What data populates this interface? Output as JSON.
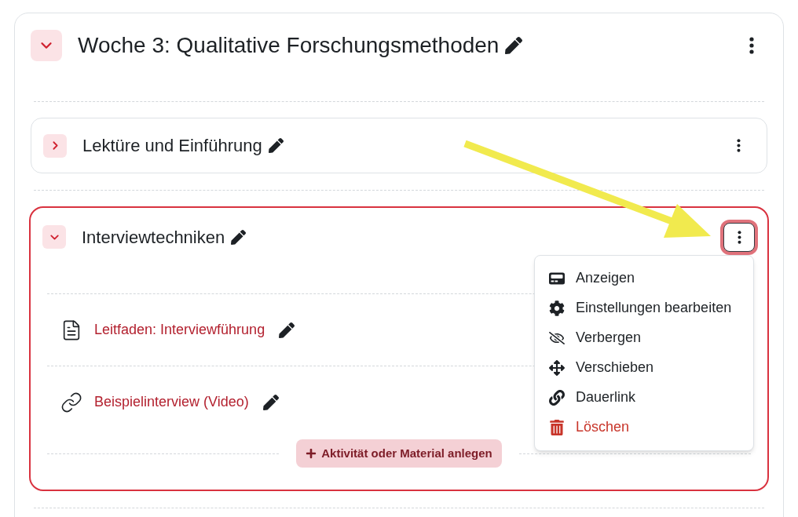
{
  "section": {
    "title": "Woche 3: Qualitative Forschungsmethoden",
    "expanded": true,
    "subsections": [
      {
        "title": "Lektüre und Einführung",
        "expanded": false,
        "highlighted": false,
        "menu_open": false
      },
      {
        "title": "Interviewtechniken",
        "expanded": true,
        "highlighted": true,
        "menu_open": true,
        "activities": [
          {
            "kind": "page",
            "title": "Leitfaden: Interviewführung"
          },
          {
            "kind": "url",
            "title": "Beispielinterview (Video)"
          }
        ],
        "add_button": "Aktivität oder Material anlegen",
        "menu": [
          {
            "kind": "view",
            "label": "Anzeigen",
            "danger": false
          },
          {
            "kind": "settings",
            "label": "Einstellungen bearbeiten",
            "danger": false
          },
          {
            "kind": "hide",
            "label": "Verbergen",
            "danger": false
          },
          {
            "kind": "move",
            "label": "Verschieben",
            "danger": false
          },
          {
            "kind": "permalink",
            "label": "Dauerlink",
            "danger": false
          },
          {
            "kind": "delete",
            "label": "Löschen",
            "danger": true
          }
        ]
      }
    ]
  }
}
